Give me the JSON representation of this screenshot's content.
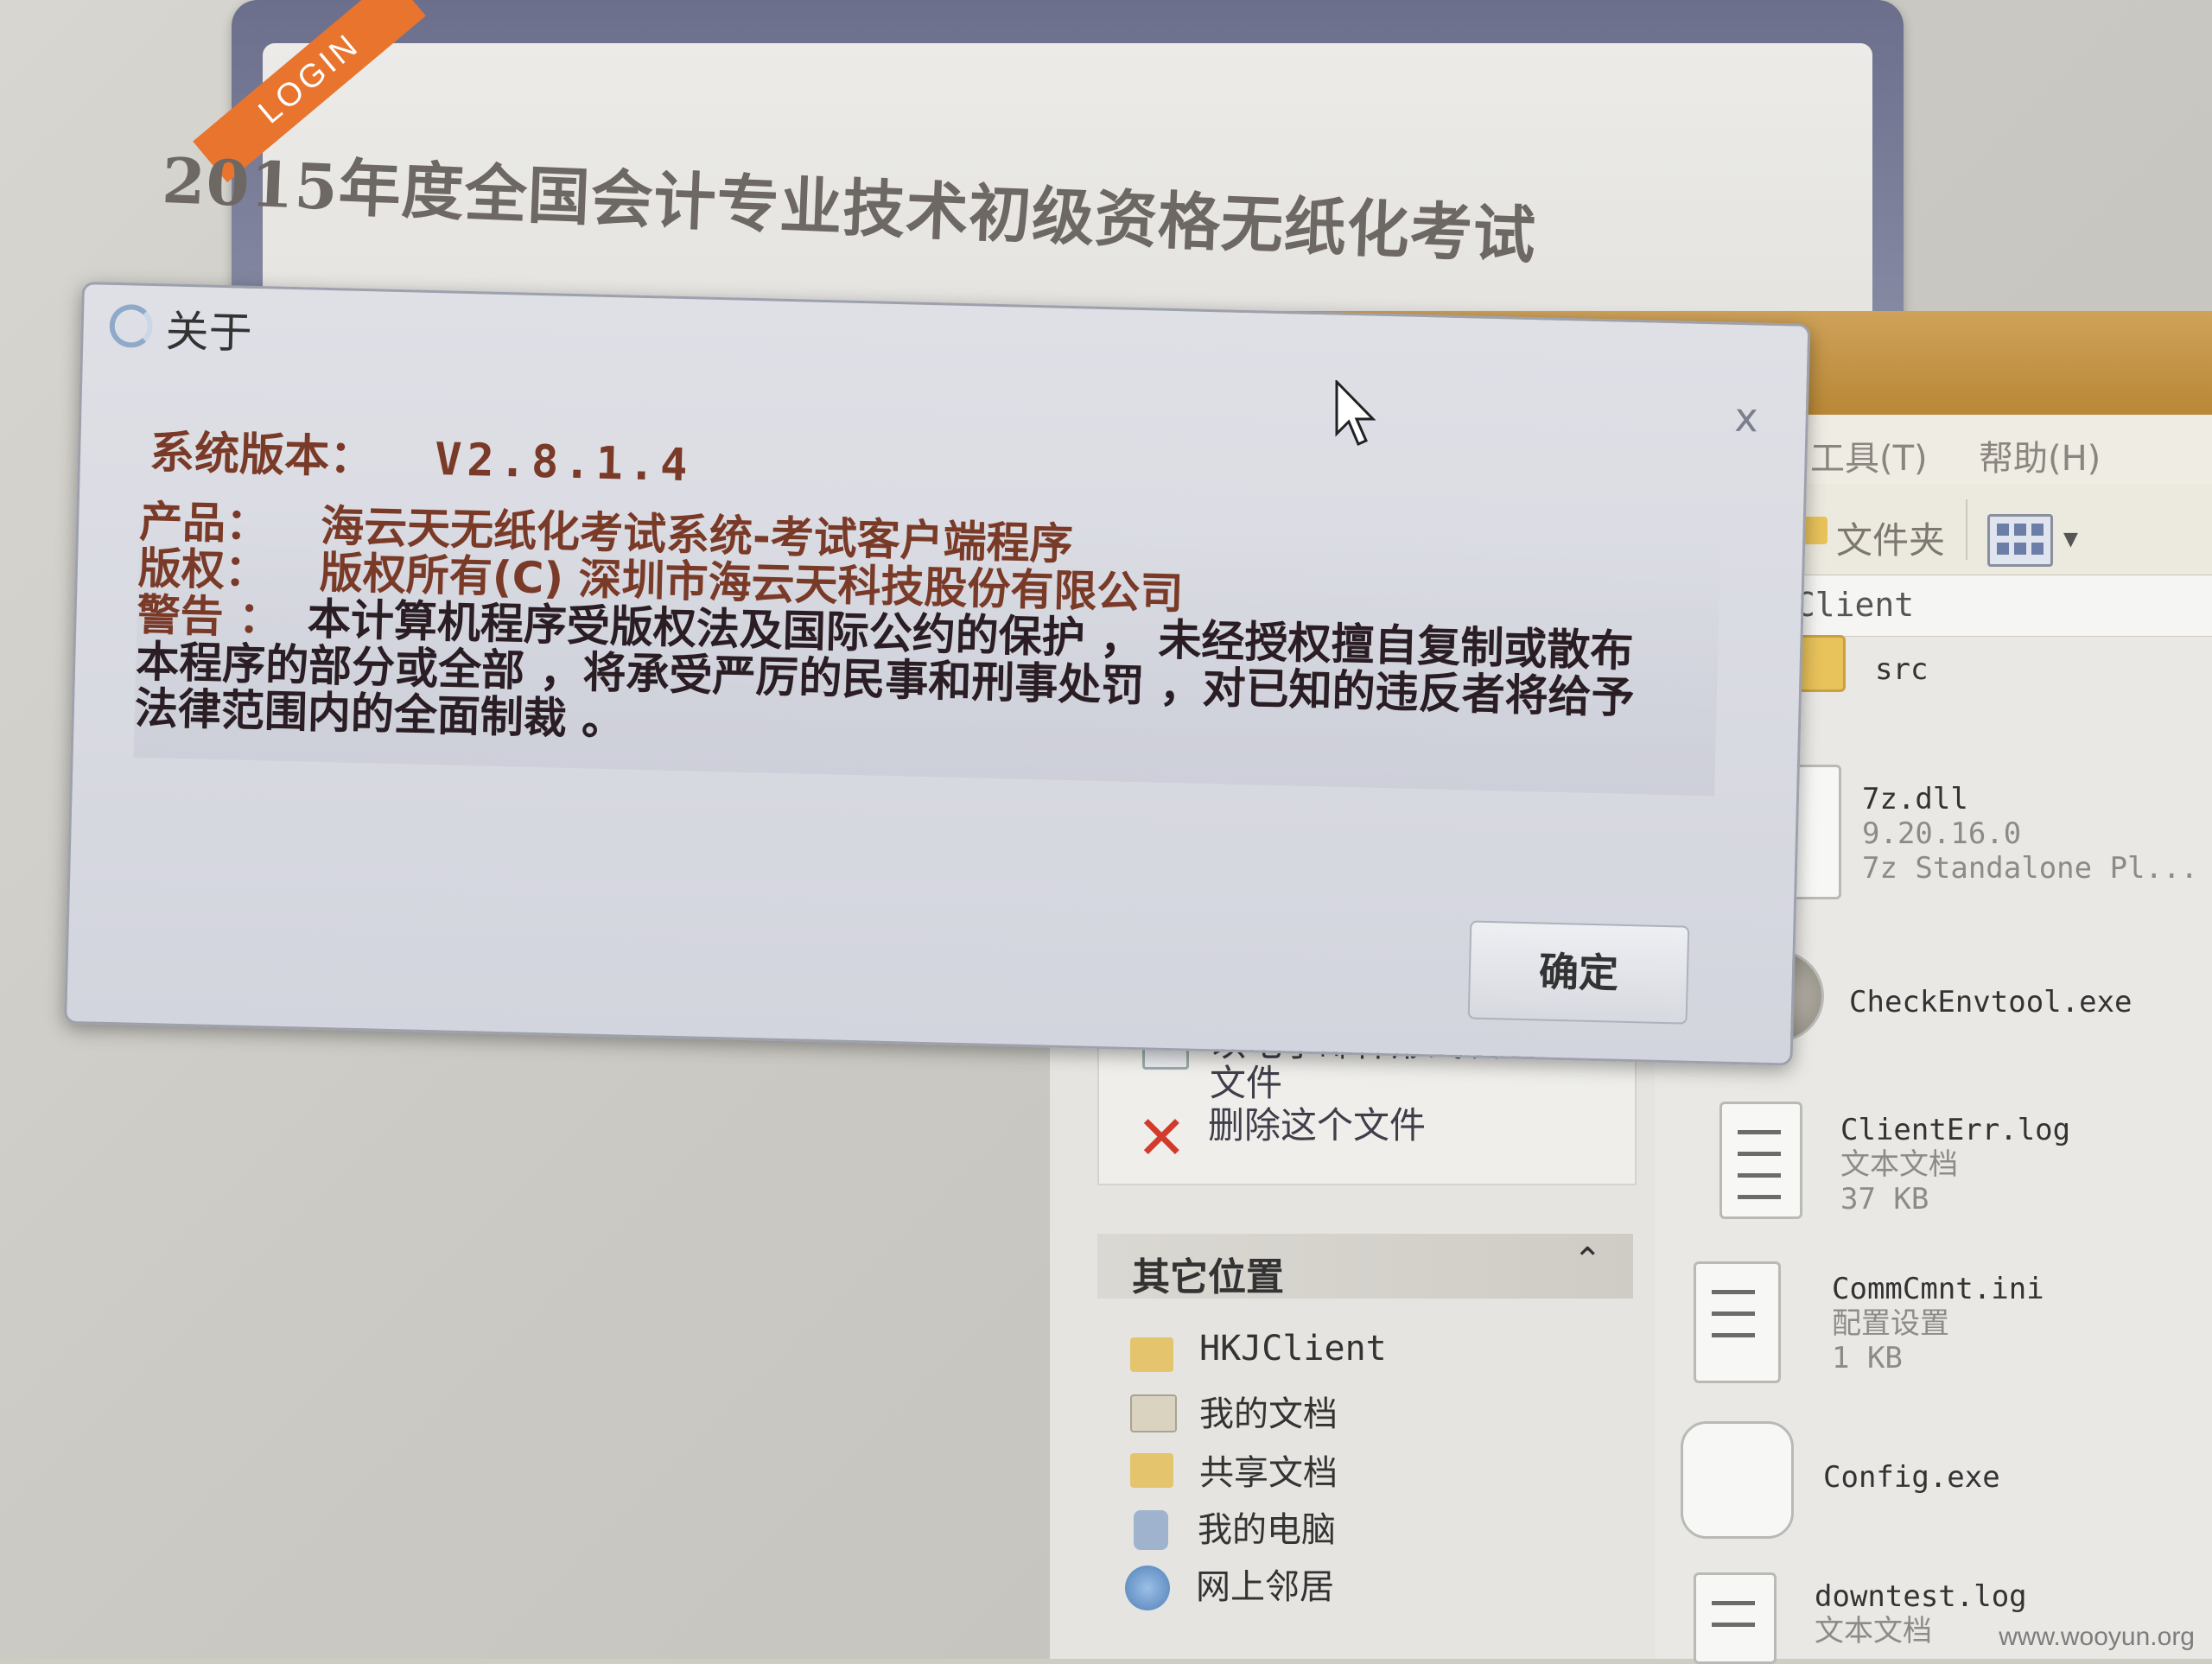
{
  "login_window": {
    "ribbon": "LOGIN",
    "title": "2015年度全国会计专业技术初级资格无纸化考试"
  },
  "explorer": {
    "menu": [
      "工具(T)",
      "帮助(H)"
    ],
    "toolbar": {
      "folders_label": "文件夹"
    },
    "address": "nClient",
    "tasks": [
      "以电子邮件形式发送此文件",
      "删除这个文件"
    ],
    "other_places": {
      "title": "其它位置",
      "items": [
        "HKJClient",
        "我的文档",
        "共享文档",
        "我的电脑",
        "网上邻居"
      ]
    },
    "files": [
      {
        "name": "src"
      },
      {
        "name": "7z.dll",
        "line2": "9.20.16.0",
        "line3": "7z Standalone Pl..."
      },
      {
        "name": "CheckEnvtool.exe"
      },
      {
        "name": "ClientErr.log",
        "line2": "文本文档",
        "line3": "37 KB"
      },
      {
        "name": "CommCmnt.ini",
        "line2": "配置设置",
        "line3": "1 KB"
      },
      {
        "name": "Config.exe"
      },
      {
        "name": "downtest.log",
        "line2": "文本文档"
      }
    ]
  },
  "dialog": {
    "title": "关于",
    "close": "x",
    "version_label": "系统版本：",
    "version_value": "V2.8.1.4",
    "product_label": "产品：",
    "product_value": "海云天无纸化考试系统-考试客户端程序",
    "copyright_label": "版权：",
    "copyright_value": "版权所有(C)  深圳市海云天科技股份有限公司",
    "warning_label": "警告 ：",
    "warning_line1": "本计算机程序受版权法及国际公约的保护 ，  未经授权擅自复制或散布",
    "warning_line2": "本程序的部分或全部 ，将承受严厉的民事和刑事处罚 ，对已知的违反者将给予",
    "warning_line3": "法律范围内的全面制裁 。",
    "ok_button": "确定"
  },
  "watermark": "www.wooyun.org"
}
